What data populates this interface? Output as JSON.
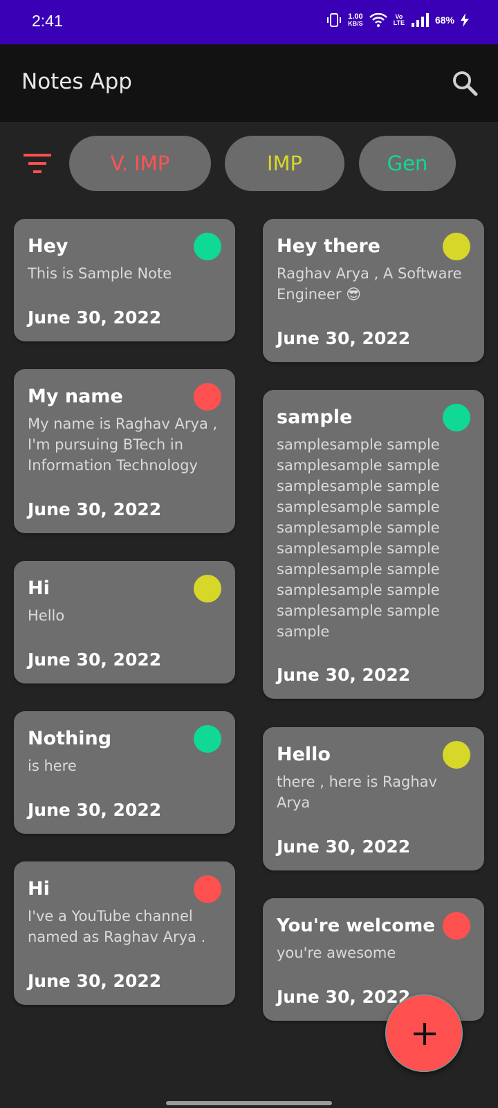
{
  "status_bar": {
    "time": "2:41",
    "net_speed_value": "1.00",
    "net_speed_unit": "KB/S",
    "volte_top": "Vo",
    "volte_bottom": "LTE",
    "battery": "68%"
  },
  "app_bar": {
    "title": "Notes App"
  },
  "filters": {
    "chips": [
      {
        "label": "V. IMP",
        "color": "#ff5454"
      },
      {
        "label": "IMP",
        "color": "#d7d729"
      },
      {
        "label": "Gen",
        "color": "#10d895"
      }
    ],
    "filter_icon_color": "#ff5050"
  },
  "priority_colors": {
    "v_imp": "#ff5050",
    "imp": "#d7d729",
    "gen": "#10d895"
  },
  "notes": [
    {
      "title": "Hey",
      "body": "This is Sample Note",
      "date": "June 30, 2022",
      "priority": "Gen"
    },
    {
      "title": "Hey there",
      "body": "Raghav Arya , A Software Engineer 😎",
      "date": "June 30, 2022",
      "priority": "IMP"
    },
    {
      "title": "My name",
      "body": "My name is Raghav Arya , I'm pursuing BTech in Information Technology",
      "date": "June 30, 2022",
      "priority": "V. IMP"
    },
    {
      "title": "sample",
      "body": "samplesample sample samplesample sample samplesample sample samplesample sample samplesample sample samplesample sample samplesample sample samplesample sample samplesample sample sample",
      "date": "June 30, 2022",
      "priority": "Gen"
    },
    {
      "title": "Hi",
      "body": "Hello",
      "date": "June 30, 2022",
      "priority": "IMP"
    },
    {
      "title": "Nothing",
      "body": "is here",
      "date": "June 30, 2022",
      "priority": "Gen"
    },
    {
      "title": "Hello",
      "body": "there , here is Raghav Arya",
      "date": "June 30, 2022",
      "priority": "IMP"
    },
    {
      "title": "Hi",
      "body": "I've a YouTube channel named as Raghav Arya .",
      "date": "June 30, 2022",
      "priority": "V. IMP"
    },
    {
      "title": "You're welcome",
      "body": "you're awesome",
      "date": "June 30, 2022",
      "priority": "V. IMP"
    }
  ],
  "fab": {
    "icon": "plus-icon",
    "color": "#ff5050"
  }
}
